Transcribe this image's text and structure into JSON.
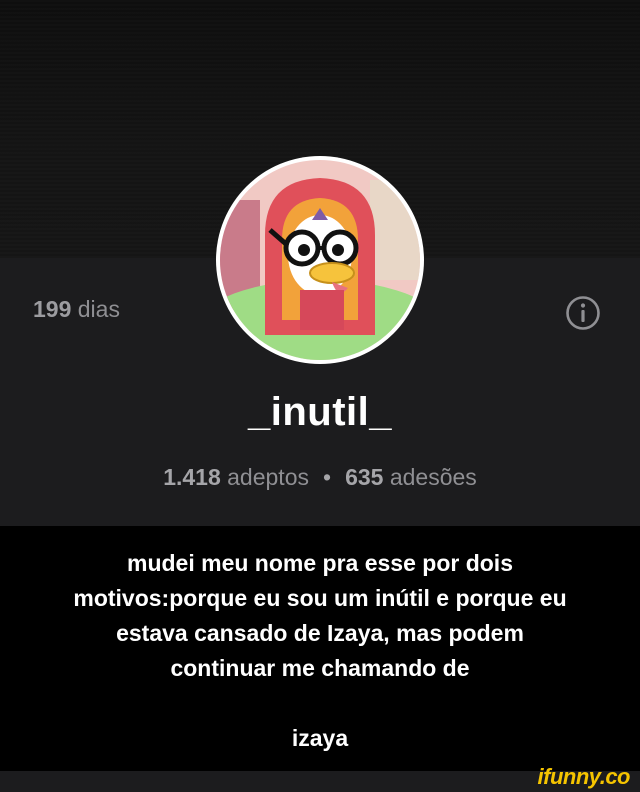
{
  "profile": {
    "days_count": "199",
    "days_label": "dias",
    "username": "_inutil_",
    "followers_count": "1.418",
    "followers_label": "adeptos",
    "separator": "•",
    "subscriptions_count": "635",
    "subscriptions_label": "adesões"
  },
  "caption": {
    "lines": [
      "mudei meu nome pra esse por dois",
      "motivos:porque eu sou um inútil e porque eu",
      "estava cansado de Izaya, mas podem",
      "continuar me chamando de"
    ],
    "final_line": "izaya"
  },
  "watermark": "ifunny.co",
  "colors": {
    "panel": "#1c1c1e",
    "muted_text": "#8f8f93",
    "watermark": "#f5c400"
  }
}
